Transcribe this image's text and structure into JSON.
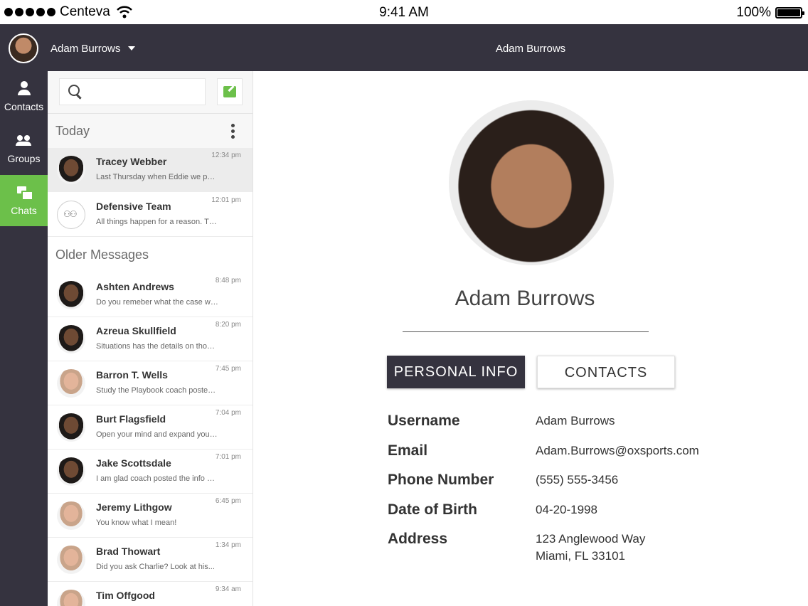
{
  "status_bar": {
    "carrier": "Centeva",
    "time": "9:41 AM",
    "battery": "100%"
  },
  "topbar": {
    "user_name": "Adam Burrows",
    "title": "Adam Burrows"
  },
  "nav": [
    {
      "label": "Contacts",
      "icon": "person-icon",
      "active": false
    },
    {
      "label": "Groups",
      "icon": "group-icon",
      "active": false
    },
    {
      "label": "Chats",
      "icon": "chat-icon",
      "active": true
    }
  ],
  "search": {
    "placeholder": ""
  },
  "sections": {
    "today": "Today",
    "older": "Older Messages"
  },
  "today_chats": [
    {
      "name": "Tracey Webber",
      "preview": "Last Thursday when Eddie we pas...",
      "time": "12:34 pm",
      "selected": true
    },
    {
      "name": "Defensive Team",
      "preview": "All things happen for a reason. Th...",
      "time": "12:01 pm",
      "selected": false
    }
  ],
  "older_chats": [
    {
      "name": "Ashten Andrews",
      "preview": "Do you remeber what the case wa...",
      "time": "8:48 pm"
    },
    {
      "name": "Azreua Skullfield",
      "preview": "Situations has the details on those...",
      "time": "8:20 pm"
    },
    {
      "name": "Barron T. Wells",
      "preview": "Study the Playbook coach posted i...",
      "time": "7:45 pm"
    },
    {
      "name": "Burt Flagsfield",
      "preview": "Open your mind and expand your t...",
      "time": "7:04 pm"
    },
    {
      "name": "Jake Scottsdale",
      "preview": "I am glad coach posted the info on...",
      "time": "7:01 pm"
    },
    {
      "name": "Jeremy Lithgow",
      "preview": "You know what I mean!",
      "time": "6:45 pm"
    },
    {
      "name": "Brad Thowart",
      "preview": "Did you ask Charlie? Look at his...",
      "time": "1:34 pm"
    },
    {
      "name": "Tim Offgood",
      "preview": "",
      "time": "9:34 am"
    }
  ],
  "profile": {
    "name": "Adam Burrows",
    "tabs": {
      "personal": "PERSONAL INFO",
      "contacts": "CONTACTS"
    },
    "fields": {
      "username_label": "Username",
      "username": "Adam Burrows",
      "email_label": "Email",
      "email": "Adam.Burrows@oxsports.com",
      "phone_label": "Phone Number",
      "phone": "(555) 555-3456",
      "dob_label": "Date of Birth",
      "dob": "04-20-1998",
      "address_label": "Address",
      "address_line1": "123 Anglewood Way",
      "address_line2": "Miami, FL 33101"
    }
  },
  "colors": {
    "dark": "#35333f",
    "accent": "#6cc04a"
  }
}
